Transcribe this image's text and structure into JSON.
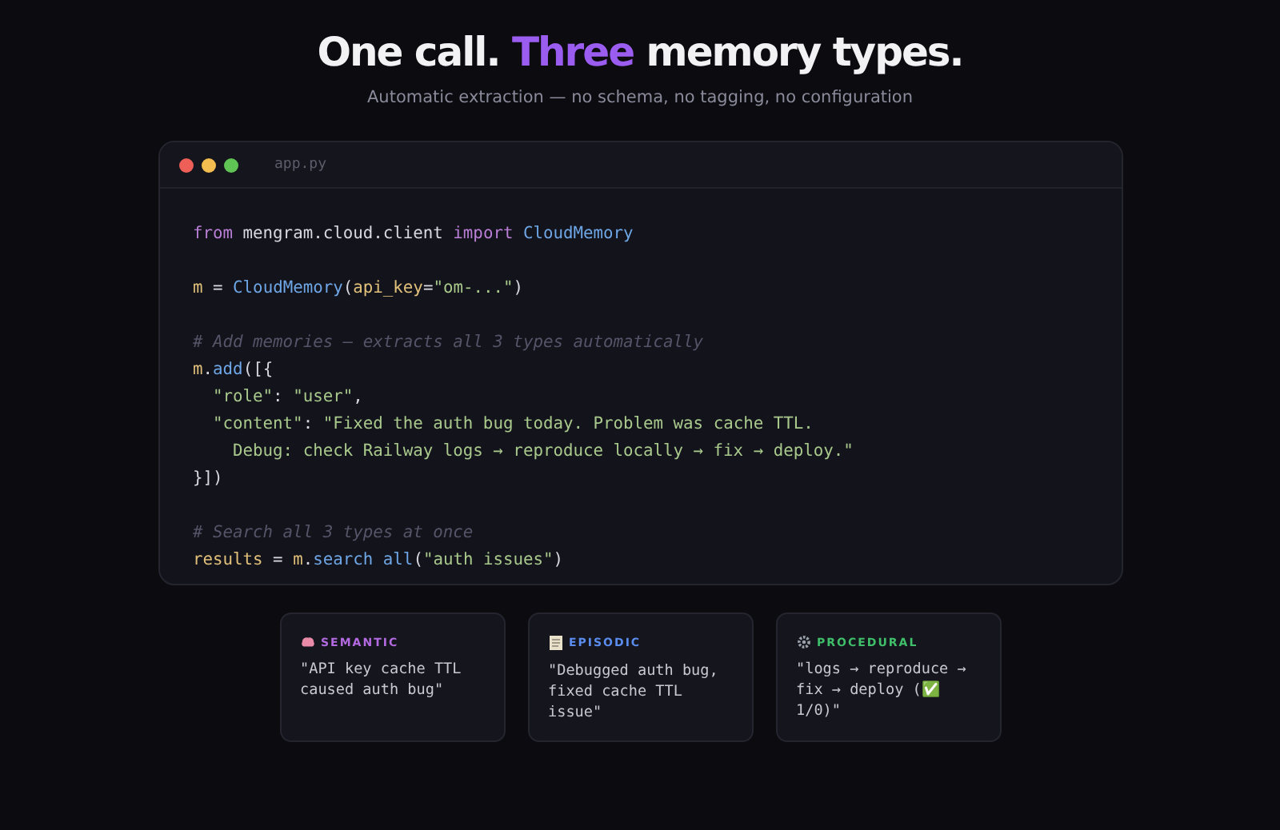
{
  "heading": {
    "parts": [
      {
        "text": "One call.",
        "highlight": false
      },
      {
        "text": "Three",
        "highlight": true
      },
      {
        "text": "memory types.",
        "highlight": false
      }
    ]
  },
  "subtitle": "Automatic extraction — no schema, no tagging, no configuration",
  "editor": {
    "filename": "app.py",
    "blocks": [
      [
        [
          {
            "kind": "keyword",
            "text": "from"
          },
          {
            "kind": "plain",
            "text": " mengram.cloud.client "
          },
          {
            "kind": "keyword",
            "text": "import"
          },
          {
            "kind": "func",
            "text": " CloudMemory"
          }
        ]
      ],
      [
        [
          {
            "kind": "var",
            "text": "m"
          },
          {
            "kind": "plain",
            "text": " = "
          },
          {
            "kind": "func",
            "text": "CloudMemory"
          },
          {
            "kind": "plain",
            "text": "("
          },
          {
            "kind": "var",
            "text": "api_key"
          },
          {
            "kind": "plain",
            "text": "="
          },
          {
            "kind": "string",
            "text": "\"om-...\""
          },
          {
            "kind": "plain",
            "text": ")"
          }
        ]
      ],
      [
        [
          {
            "kind": "comment",
            "text": "# Add memories — extracts all 3 types automatically"
          }
        ],
        [
          {
            "kind": "var",
            "text": "m"
          },
          {
            "kind": "plain",
            "text": "."
          },
          {
            "kind": "func",
            "text": "add"
          },
          {
            "kind": "plain",
            "text": "([{"
          }
        ],
        [
          {
            "kind": "string",
            "text": "  \"role\""
          },
          {
            "kind": "plain",
            "text": ": "
          },
          {
            "kind": "string",
            "text": "\"user\""
          },
          {
            "kind": "plain",
            "text": ","
          }
        ],
        [
          {
            "kind": "string",
            "text": "  \"content\""
          },
          {
            "kind": "plain",
            "text": ": "
          },
          {
            "kind": "string",
            "text": "\"Fixed the auth bug today. Problem was cache TTL."
          }
        ],
        [
          {
            "kind": "string",
            "text": "    Debug: check Railway logs → reproduce locally → fix → deploy.\""
          }
        ],
        [
          {
            "kind": "plain",
            "text": "}])"
          }
        ]
      ],
      [
        [
          {
            "kind": "comment",
            "text": "# Search all 3 types at once"
          }
        ],
        [
          {
            "kind": "var",
            "text": "results"
          },
          {
            "kind": "plain",
            "text": " = "
          },
          {
            "kind": "var",
            "text": "m"
          },
          {
            "kind": "plain",
            "text": "."
          },
          {
            "kind": "func",
            "text": "search"
          },
          {
            "kind": "func",
            "text": " all"
          },
          {
            "kind": "plain",
            "text": "("
          },
          {
            "kind": "string",
            "text": "\"auth issues\""
          },
          {
            "kind": "plain",
            "text": ")"
          }
        ]
      ]
    ]
  },
  "memory_cards": [
    {
      "kind": "brain",
      "label": "SEMANTIC",
      "color": "#b36ae0",
      "text": "\"API key cache TTL caused auth bug\""
    },
    {
      "kind": "notepad",
      "label": "EPISODIC",
      "color": "#5b8def",
      "text": "\"Debugged auth bug, fixed cache TTL issue\""
    },
    {
      "kind": "gear",
      "label": "PROCEDURAL",
      "color": "#3fbf6a",
      "text": "\"logs → reproduce → fix → deploy (✅ 1/0)\""
    }
  ]
}
